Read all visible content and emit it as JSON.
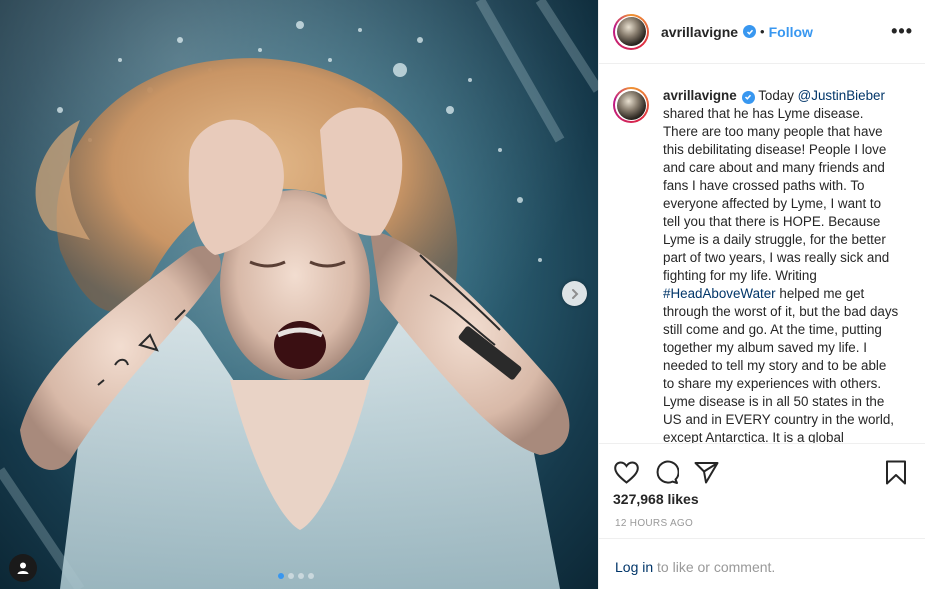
{
  "post": {
    "username": "avrillavigne",
    "separator": "•",
    "follow_label": "Follow",
    "more_label": "•••",
    "carousel": {
      "slide_count": 4,
      "active_slide": 1
    },
    "caption": {
      "prefix": "Today",
      "mention": "@JustinBieber",
      "text_1": "shared that he has Lyme disease. There are too many people that have this debilitating disease! People I love and care about and many friends and fans I have crossed paths with. To everyone affected by Lyme, I want to tell you that there is HOPE. Because Lyme is a daily struggle, for the better part of two years, I was really sick and fighting for my life. Writing",
      "hashtag": "#HeadAboveWater",
      "text_2": "helped me get through the worst of it, but the bad days still come and go. At the time, putting together my album saved my life. I needed to tell my story and to be able to share my experiences with others. Lyme disease is in all 50 states in the US and in EVERY country in the world, except Antarctica. It is a global"
    },
    "likes": "327,968 likes",
    "timestamp": "12 HOURS AGO",
    "login_link": "Log in",
    "login_suffix": "to like or comment."
  },
  "icons": {
    "like": "heart-icon",
    "comment": "comment-icon",
    "share": "share-icon",
    "save": "bookmark-icon",
    "next": "chevron-right-icon",
    "tag": "user-tag-icon",
    "verified": "verified-badge-icon"
  },
  "colors": {
    "accent": "#3897f0",
    "link": "#003569",
    "muted": "#999999",
    "border": "#efefef"
  }
}
